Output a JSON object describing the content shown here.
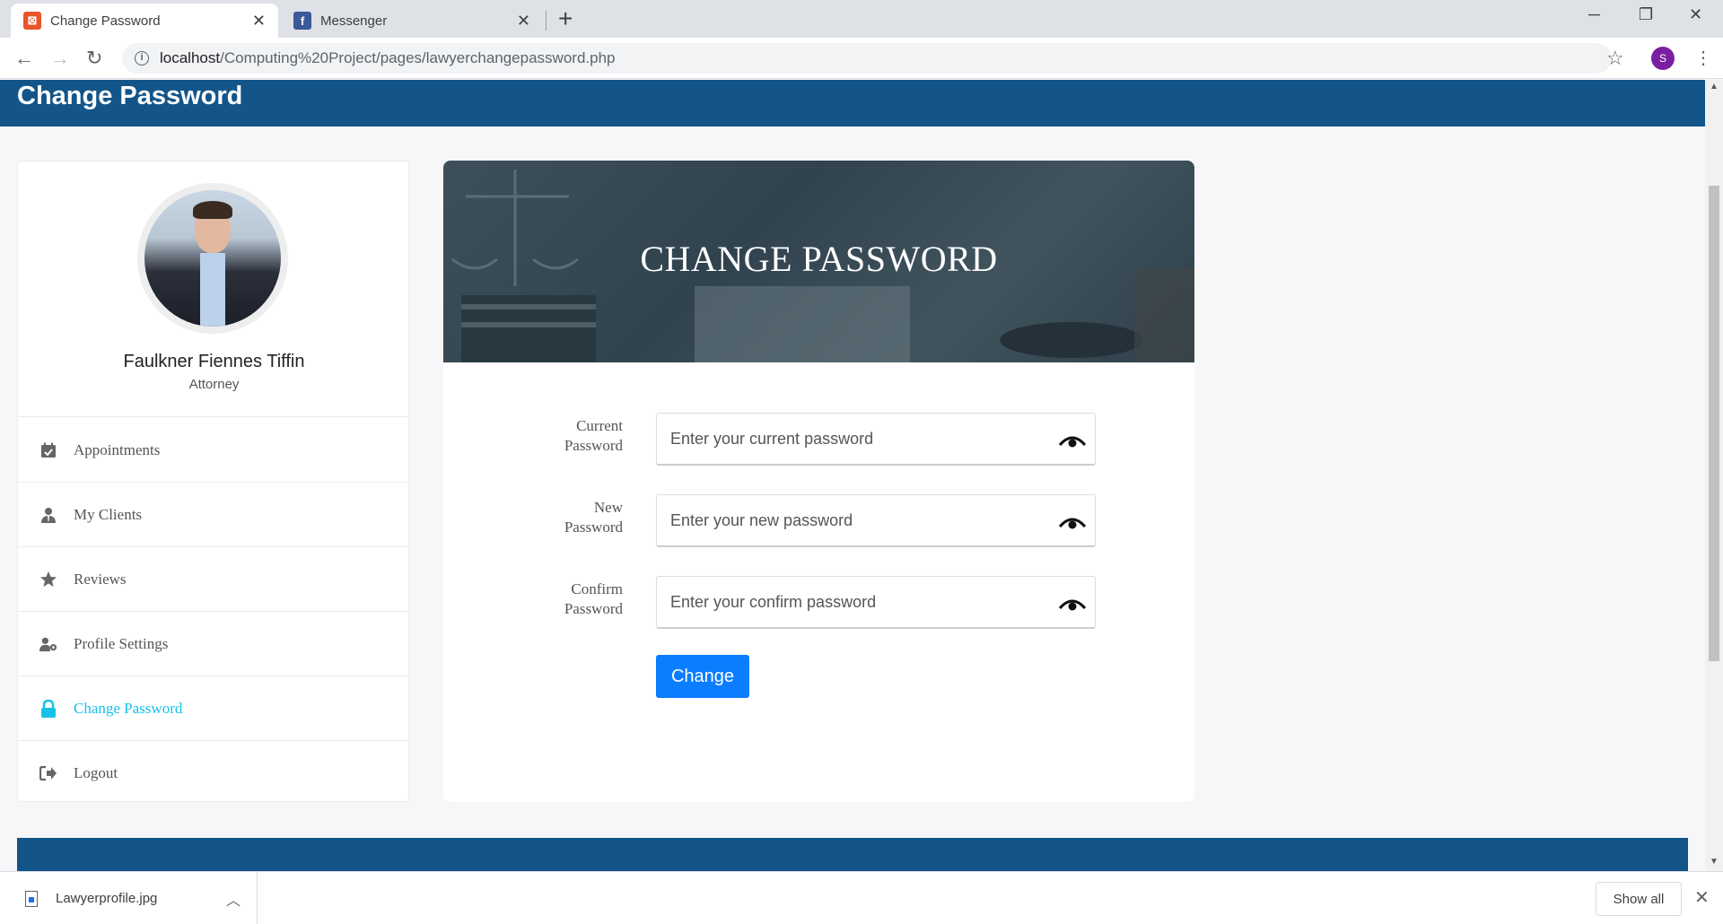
{
  "browser": {
    "tabs": [
      {
        "title": "Change Password",
        "close": "✕"
      },
      {
        "title": "Messenger",
        "close": "✕"
      }
    ],
    "new_tab": "+",
    "url_host": "localhost",
    "url_path": "/Computing%20Project/pages/lawyerchangepassword.php",
    "profile_initial": "S"
  },
  "header": {
    "title": "Change Password"
  },
  "profile": {
    "name": "Faulkner Fiennes Tiffin",
    "role": "Attorney"
  },
  "nav": {
    "items": [
      {
        "label": "Appointments",
        "icon": "calendar-check-icon"
      },
      {
        "label": "My Clients",
        "icon": "user-tie-icon"
      },
      {
        "label": "Reviews",
        "icon": "star-icon"
      },
      {
        "label": "Profile Settings",
        "icon": "user-cog-icon"
      },
      {
        "label": "Change Password",
        "icon": "lock-icon",
        "active": true
      },
      {
        "label": "Logout",
        "icon": "sign-out-icon"
      }
    ]
  },
  "card": {
    "banner_title": "CHANGE PASSWORD"
  },
  "form": {
    "current": {
      "label_line1": "Current",
      "label_line2": "Password",
      "placeholder": "Enter your current password"
    },
    "new": {
      "label_line1": "New",
      "label_line2": "Password",
      "placeholder": "Enter your new password"
    },
    "confirm": {
      "label_line1": "Confirm",
      "label_line2": "Password",
      "placeholder": "Enter your confirm password"
    },
    "submit_label": "Change"
  },
  "downloads": {
    "file_name": "Lawyerprofile.jpg",
    "show_all": "Show all"
  },
  "colors": {
    "brand_blue": "#135589",
    "active_nav": "#17c1e8",
    "button": "#0b7dff"
  }
}
